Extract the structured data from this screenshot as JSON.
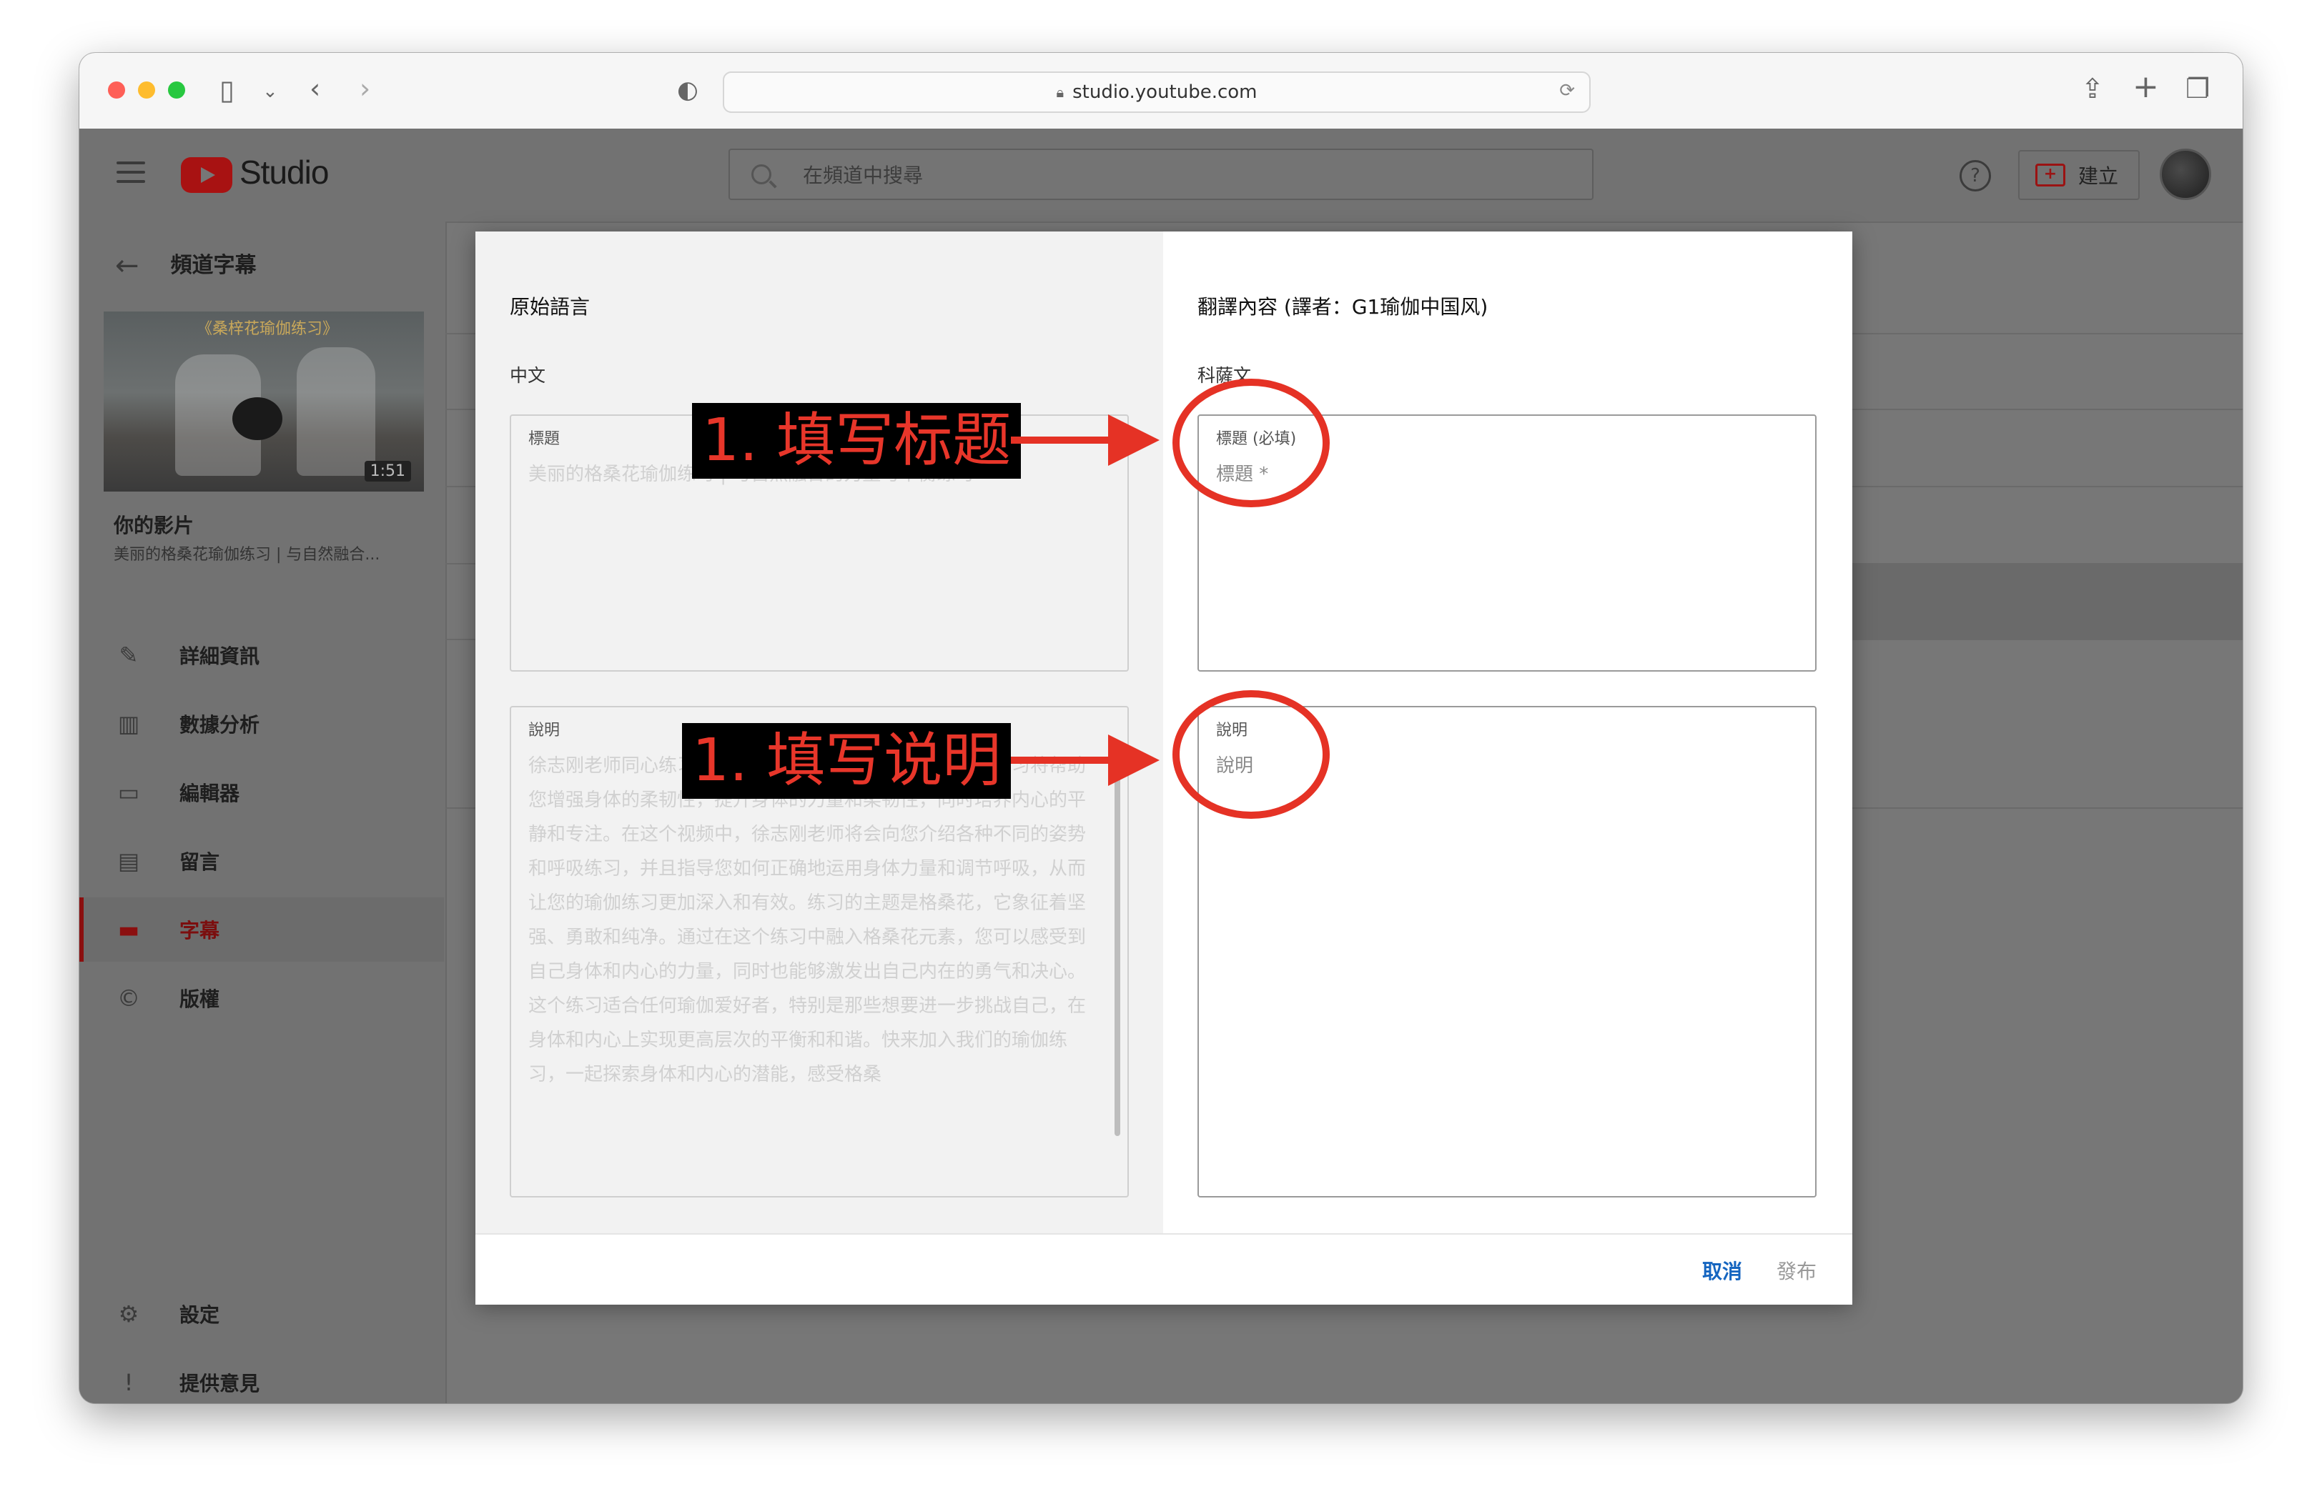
{
  "browser": {
    "url": "studio.youtube.com"
  },
  "header": {
    "brand": "Studio",
    "search_placeholder": "在頻道中搜尋",
    "help_glyph": "?",
    "create_label": "建立"
  },
  "sidebar": {
    "back_title": "頻道字幕",
    "video_duration": "1:51",
    "thumbnail_banner": "《桑梓花瑜伽练习》",
    "your_video": "你的影片",
    "video_title": "美丽的格桑花瑜伽练习 | 与自然融合...",
    "items": [
      {
        "label": "詳細資訊",
        "icon": "pencil-icon",
        "glyph": "✎"
      },
      {
        "label": "數據分析",
        "icon": "analytics-icon",
        "glyph": "▥"
      },
      {
        "label": "編輯器",
        "icon": "editor-icon",
        "glyph": "▭"
      },
      {
        "label": "留言",
        "icon": "comments-icon",
        "glyph": "▤"
      },
      {
        "label": "字幕",
        "icon": "subtitles-icon",
        "glyph": "▬"
      },
      {
        "label": "版權",
        "icon": "copyright-icon",
        "glyph": "©"
      }
    ],
    "bottom_items": [
      {
        "label": "設定",
        "icon": "gear-icon",
        "glyph": "⚙"
      },
      {
        "label": "提供意見",
        "icon": "feedback-icon",
        "glyph": "!"
      }
    ]
  },
  "dialog": {
    "left": {
      "title": "原始語言",
      "language": "中文",
      "title_field": {
        "label": "標題",
        "value": "美丽的格桑花瑜伽练习 | 与自然融合的力量与平衡练习"
      },
      "desc_field": {
        "label": "說明",
        "value": "徐志刚老师同心练习，将瑜伽的力量与自然相结合。这个练习将帮助您增强身体的柔韧性，提升身体的力量和柔韧性，同时培养内心的平静和专注。在这个视频中，徐志刚老师将会向您介绍各种不同的姿势和呼吸练习，并且指导您如何正确地运用身体力量和调节呼吸，从而让您的瑜伽练习更加深入和有效。练习的主题是格桑花，它象征着坚强、勇敢和纯净。通过在这个练习中融入格桑花元素，您可以感受到自己身体和内心的力量，同时也能够激发出自己内在的勇气和决心。这个练习适合任何瑜伽爱好者，特别是那些想要进一步挑战自己，在身体和内心上实现更高层次的平衡和和谐。快来加入我们的瑜伽练习，一起探索身体和内心的潜能，感受格桑"
      }
    },
    "right": {
      "title": "翻譯內容 (譯者：G1瑜伽中国风)",
      "language": "科薩文",
      "title_field": {
        "label": "標題 (必填)",
        "placeholder": "標題 *"
      },
      "desc_field": {
        "label": "說明",
        "placeholder": "說明"
      }
    },
    "footer": {
      "cancel": "取消",
      "publish": "發布"
    }
  },
  "annotations": {
    "step_title": "1. 填写标题",
    "step_desc": "1. 填写说明",
    "color": "#e53225"
  }
}
